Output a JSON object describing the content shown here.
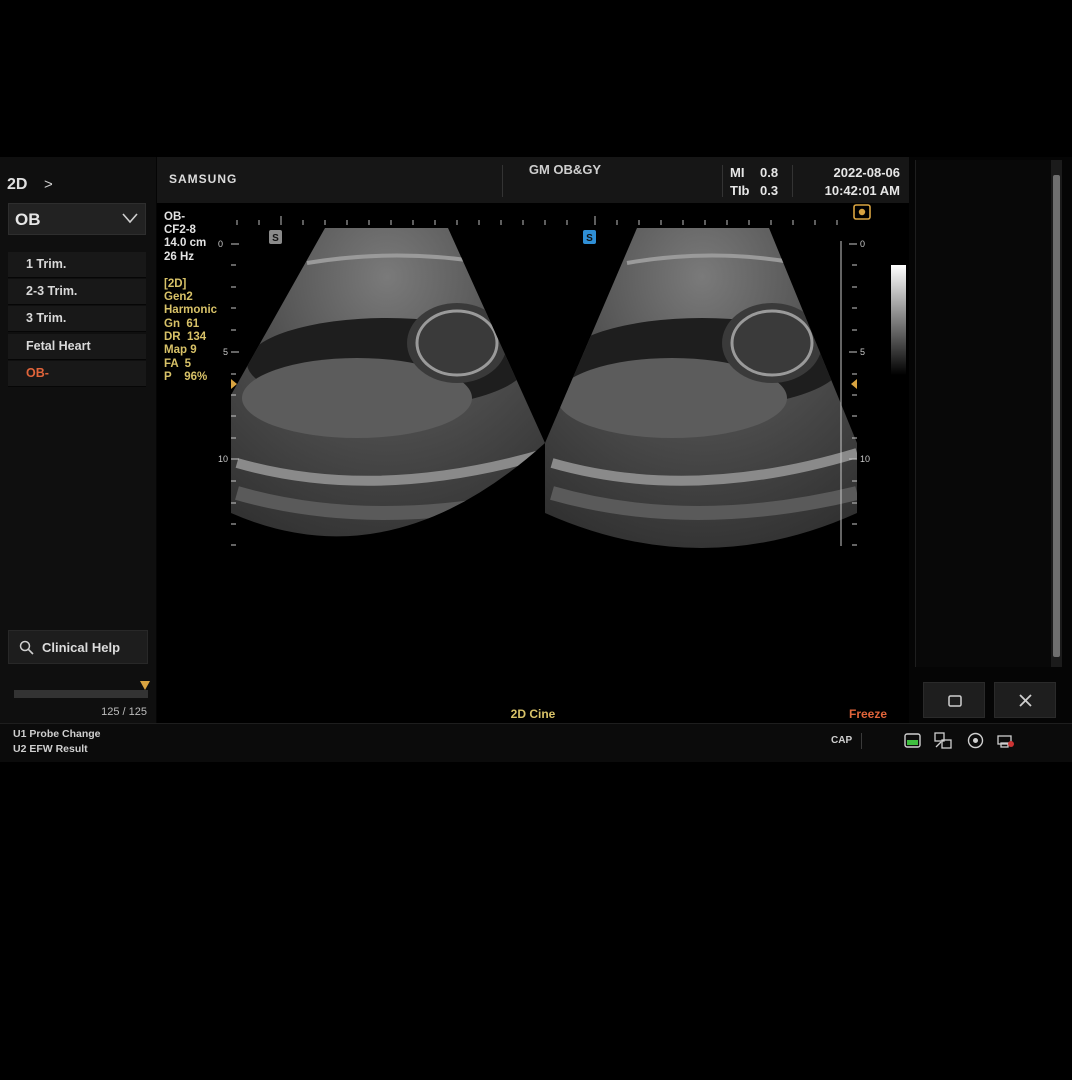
{
  "left_panel": {
    "mode": "2D",
    "mode_chevron": ">",
    "preset": "OB",
    "presets": [
      {
        "label": "1 Trim.",
        "active": false
      },
      {
        "label": "2-3 Trim.",
        "active": false
      },
      {
        "label": "3 Trim.",
        "active": false
      },
      {
        "label": "Fetal Heart",
        "active": false
      },
      {
        "label": "OB-",
        "active": true
      }
    ],
    "clinical_help": "Clinical Help",
    "cine_count": "125 / 125"
  },
  "header": {
    "brand": "SAMSUNG",
    "exam": "GM OB&GY",
    "mi_label": "MI",
    "mi_value": "0.8",
    "tib_label": "TIb",
    "tib_value": "0.3",
    "date": "2022-08-06",
    "time": "10:42:01 AM"
  },
  "params": {
    "probe": [
      "OB-",
      "CF2-8",
      "14.0 cm",
      "26 Hz"
    ],
    "settings": [
      "[2D]",
      "Gen2",
      "Harmonic",
      "Gn  61",
      "DR  134",
      "Map 9",
      "FA  5",
      "P    96%"
    ]
  },
  "depth_scale": {
    "left_labels": [
      "0",
      "5",
      "10"
    ],
    "right_labels": [
      "0",
      "5",
      "10"
    ],
    "marker_left": "S",
    "marker_right": "S"
  },
  "status": {
    "cine": "2D Cine",
    "freeze": "Freeze"
  },
  "bottom": {
    "u1": "U1  Probe Change",
    "u2": "U2  EFW Result",
    "cap": "CAP"
  },
  "icons": {
    "window": "window-icon",
    "close": "close-icon",
    "search": "search-icon",
    "battery": "battery-icon",
    "network": "network-icon",
    "disc": "disc-icon",
    "printer": "printer-icon"
  },
  "colors": {
    "accent_orange": "#e0643a",
    "param_yellow": "#d8c268",
    "marker_blue": "#2f8fd6"
  }
}
